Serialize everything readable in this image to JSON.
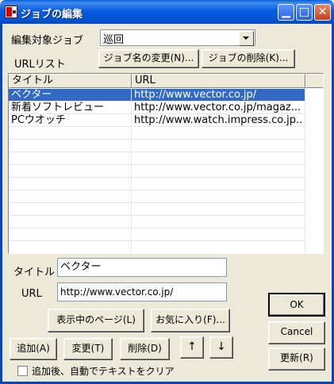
{
  "window": {
    "title": "ジョブの編集"
  },
  "job_select": {
    "label": "編集対象ジョブ",
    "value": "巡回"
  },
  "url_list": {
    "label": "URLリスト",
    "rename_button": "ジョブ名の変更(N)...",
    "delete_job_button": "ジョブの削除(K)...",
    "columns": [
      "タイトル",
      "URL"
    ],
    "rows": [
      {
        "title": "ベクター",
        "url": "http://www.vector.co.jp/"
      },
      {
        "title": "新着ソフトレビュー",
        "url": "http://www.vector.co.jp/magaz..."
      },
      {
        "title": "PCウオッチ",
        "url": "http://www.watch.impress.co.jp..."
      }
    ],
    "selected_index": 0
  },
  "form": {
    "title_label": "タイトル",
    "title_value": "ベクター",
    "url_label": "URL",
    "url_value": "http://www.vector.co.jp/"
  },
  "buttons": {
    "current_page": "表示中のページ(L)",
    "favorites": "お気に入り(F)...",
    "add": "追加(A)",
    "change": "変更(T)",
    "delete": "削除(D)",
    "up": "↑",
    "down": "↓",
    "ok": "OK",
    "cancel": "Cancel",
    "update": "更新(R)"
  },
  "options": {
    "clear_after_add_label": "追加後、自動でテキストをクリア",
    "clear_after_add_checked": false
  },
  "colors": {
    "title_bar": "#0A5FD8",
    "selection": "#316AC5",
    "dialog_bg": "#ECE9D8"
  }
}
